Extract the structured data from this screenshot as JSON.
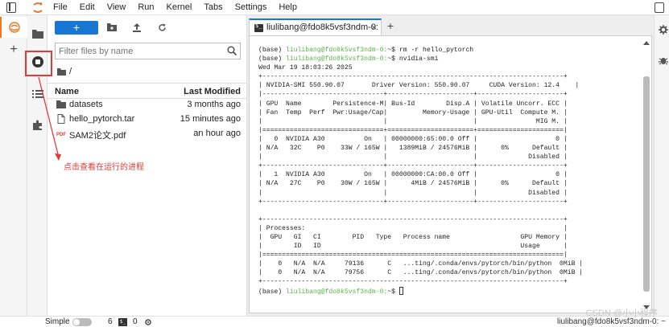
{
  "menu": {
    "items": [
      "File",
      "Edit",
      "View",
      "Run",
      "Kernel",
      "Tabs",
      "Settings",
      "Help"
    ]
  },
  "icons": {
    "activity": [
      "jupyter-logo-icon",
      "plus-icon",
      "folder-icon",
      "stop-circle-icon",
      "list-icon",
      "puzzle-icon"
    ],
    "right": [
      "gear-icon",
      "bug-icon"
    ]
  },
  "filebrowser": {
    "new_label": "+",
    "filter_placeholder": "Filter files by name",
    "breadcrumb": "/",
    "col_name": "Name",
    "col_modified": "Last Modified",
    "files": [
      {
        "name": "datasets",
        "modified": "3 months ago",
        "icon": "folder-icon"
      },
      {
        "name": "hello_pytorch.tar",
        "modified": "15 minutes ago",
        "icon": "file-icon"
      },
      {
        "name": "SAM2论文.pdf",
        "modified": "an hour ago",
        "icon": "pdf-icon"
      }
    ]
  },
  "annotation": {
    "text": "点击查看在运行的进程",
    "color": "#e53935"
  },
  "terminal": {
    "tab_label": "liulibang@fdo8k5vsf3ndm-0:",
    "tab_close": "×",
    "add_tab": "+",
    "lines": [
      {
        "pre": "(base) ",
        "green": "liulibang@fdo8k5vsf3ndm-0:",
        "post": "~$ rm -r hello_pytorch"
      },
      {
        "pre": "(base) ",
        "green": "liulibang@fdo8k5vsf3ndm-0:",
        "post": "~$ nvidia-smi"
      },
      {
        "pre": "Wed Mar 19 18:03:26 2025",
        "green": "",
        "post": ""
      },
      {
        "pre": "+-----------------------------------------------------------------------------+",
        "green": "",
        "post": ""
      },
      {
        "pre": "| NVIDIA-SMI 550.90.07       Driver Version: 550.90.07     CUDA Version: 12.4    |",
        "green": "",
        "post": ""
      },
      {
        "pre": "|-------------------------------+----------------------+----------------------+",
        "green": "",
        "post": ""
      },
      {
        "pre": "| GPU  Name        Persistence-M| Bus-Id        Disp.A | Volatile Uncorr. ECC |",
        "green": "",
        "post": ""
      },
      {
        "pre": "| Fan  Temp  Perf  Pwr:Usage/Cap|         Memory-Usage | GPU-Util  Compute M. |",
        "green": "",
        "post": ""
      },
      {
        "pre": "|                               |                      |               MIG M. |",
        "green": "",
        "post": ""
      },
      {
        "pre": "|===============================+======================+======================|",
        "green": "",
        "post": ""
      },
      {
        "pre": "|   0  NVIDIA A30          On   | 00000000:65:00.0 Off |                    0 |",
        "green": "",
        "post": ""
      },
      {
        "pre": "| N/A   32C    P0    33W / 165W |   1389MiB / 24576MiB |      0%      Default |",
        "green": "",
        "post": ""
      },
      {
        "pre": "|                               |                      |             Disabled |",
        "green": "",
        "post": ""
      },
      {
        "pre": "+-------------------------------+----------------------+----------------------+",
        "green": "",
        "post": ""
      },
      {
        "pre": "|   1  NVIDIA A30          On   | 00000000:CA:00.0 Off |                    0 |",
        "green": "",
        "post": ""
      },
      {
        "pre": "| N/A   27C    P0    30W / 165W |      4MiB / 24576MiB |      0%      Default |",
        "green": "",
        "post": ""
      },
      {
        "pre": "|                               |                      |             Disabled |",
        "green": "",
        "post": ""
      },
      {
        "pre": "+-------------------------------+----------------------+----------------------+",
        "green": "",
        "post": ""
      },
      {
        "pre": "",
        "green": "",
        "post": ""
      },
      {
        "pre": "+-----------------------------------------------------------------------------+",
        "green": "",
        "post": ""
      },
      {
        "pre": "| Processes:                                                                  |",
        "green": "",
        "post": ""
      },
      {
        "pre": "|  GPU   GI   CI        PID   Type   Process name                  GPU Memory |",
        "green": "",
        "post": ""
      },
      {
        "pre": "|        ID   ID                                                   Usage      |",
        "green": "",
        "post": ""
      },
      {
        "pre": "|=============================================================================|",
        "green": "",
        "post": ""
      },
      {
        "pre": "|    0   N/A  N/A     79136      C   ...ting/.conda/envs/pytorch/bin/python  0MiB |",
        "green": "",
        "post": ""
      },
      {
        "pre": "|    0   N/A  N/A     79756      C   ...ting/.conda/envs/pytorch/bin/python  0MiB |",
        "green": "",
        "post": ""
      },
      {
        "pre": "+-----------------------------------------------------------------------------+",
        "green": "",
        "post": ""
      },
      {
        "pre": "(base) ",
        "green": "liulibang@fdo8k5vsf3ndm-0:",
        "post": "~$ "
      }
    ]
  },
  "status": {
    "simple_label": "Simple",
    "count_a": "6",
    "count_b": "0",
    "right_text": "liulibang@fdo8k5vsf3ndm-0: ~"
  },
  "watermark": "CSDN @小小程序"
}
